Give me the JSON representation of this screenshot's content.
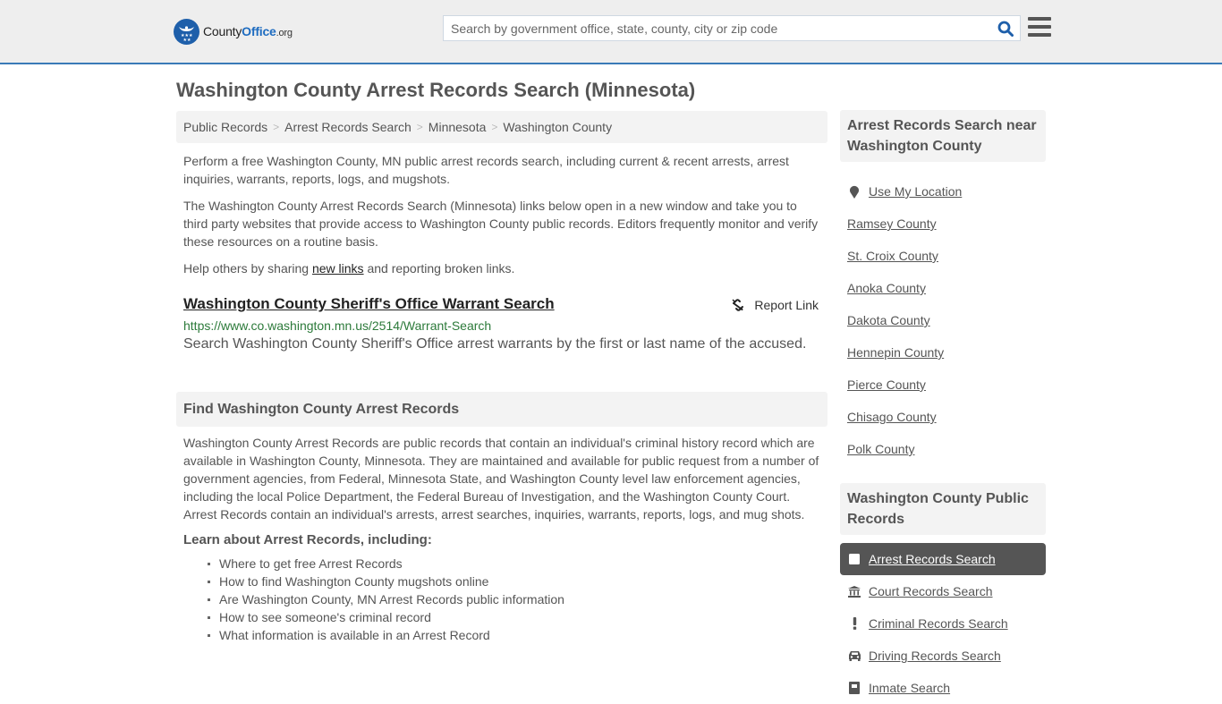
{
  "header": {
    "logo": {
      "name_part1": "County",
      "name_part2": "Office",
      "suffix": ".org"
    },
    "search": {
      "placeholder": "Search by government office, state, county, city or zip code",
      "value": ""
    },
    "brand_color": "#1e5faa",
    "accent_border": "#3a7ab7"
  },
  "page": {
    "title": "Washington County Arrest Records Search (Minnesota)"
  },
  "breadcrumb": [
    {
      "label": "Public Records"
    },
    {
      "label": "Arrest Records Search"
    },
    {
      "label": "Minnesota"
    },
    {
      "label": "Washington County"
    }
  ],
  "intro": {
    "p1": "Perform a free Washington County, MN public arrest records search, including current & recent arrests, arrest inquiries, warrants, reports, logs, and mugshots.",
    "p2": "The Washington County Arrest Records Search (Minnesota) links below open in a new window and take you to third party websites that provide access to Washington County public records. Editors frequently monitor and verify these resources on a routine basis.",
    "p3_before": "Help others by sharing ",
    "p3_link": "new links",
    "p3_after": " and reporting broken links."
  },
  "results": [
    {
      "title": "Washington County Sheriff's Office Warrant Search",
      "url": "https://www.co.washington.mn.us/2514/Warrant-Search",
      "description": "Search Washington County Sheriff's Office arrest warrants by the first or last name of the accused.",
      "report_label": "Report Link"
    }
  ],
  "find_section": {
    "heading": "Find Washington County Arrest Records",
    "body": "Washington County Arrest Records are public records that contain an individual's criminal history record which are available in Washington County, Minnesota. They are maintained and available for public request from a number of government agencies, from Federal, Minnesota State, and Washington County level law enforcement agencies, including the local Police Department, the Federal Bureau of Investigation, and the Washington County Court. Arrest Records contain an individual's arrests, arrest searches, inquiries, warrants, reports, logs, and mug shots.",
    "learn_heading": "Learn about Arrest Records, including:",
    "learn_items": [
      "Where to get free Arrest Records",
      "How to find Washington County mugshots online",
      "Are Washington County, MN Arrest Records public information",
      "How to see someone's criminal record",
      "What information is available in an Arrest Record"
    ]
  },
  "sidebar": {
    "nearby_heading": "Arrest Records Search near Washington County",
    "use_location": "Use My Location",
    "nearby": [
      "Ramsey County",
      "St. Croix County",
      "Anoka County",
      "Dakota County",
      "Hennepin County",
      "Pierce County",
      "Chisago County",
      "Polk County"
    ],
    "records_heading": "Washington County Public Records",
    "records": [
      {
        "label": "Arrest Records Search",
        "icon": "square-icon",
        "active": true
      },
      {
        "label": "Court Records Search",
        "icon": "courthouse-icon",
        "active": false
      },
      {
        "label": "Criminal Records Search",
        "icon": "exclamation-icon",
        "active": false
      },
      {
        "label": "Driving Records Search",
        "icon": "car-icon",
        "active": false
      },
      {
        "label": "Inmate Search",
        "icon": "inmate-icon",
        "active": false
      }
    ]
  }
}
